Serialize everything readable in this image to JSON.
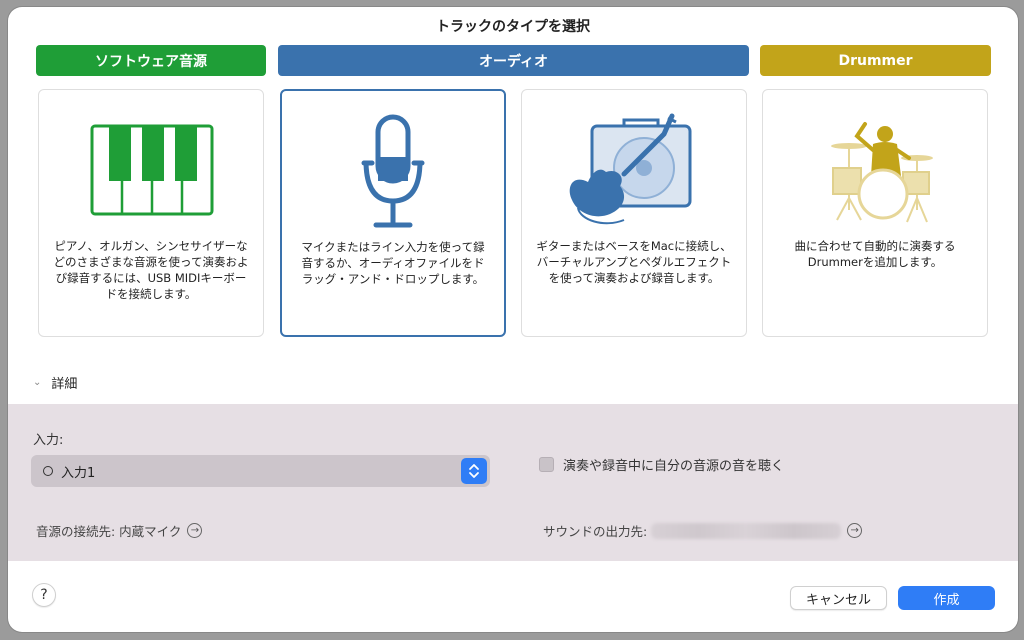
{
  "dialog": {
    "title": "トラックのタイプを選択"
  },
  "categories": [
    {
      "label": "ソフトウェア音源",
      "color": "#1f9e37"
    },
    {
      "label": "オーディオ",
      "color": "#3a72ad"
    },
    {
      "label": "Drummer",
      "color": "#c2a41a"
    }
  ],
  "cards": [
    {
      "icon": "piano-keyboard-icon",
      "description": "ピアノ、オルガン、シンセサイザーなどのさまざまな音源を使って演奏および録音するには、USB MIDIキーボードを接続します。",
      "selected": false
    },
    {
      "icon": "microphone-icon",
      "description": "マイクまたはライン入力を使って録音するか、オーディオファイルをドラッグ・アンド・ドロップします。",
      "selected": true
    },
    {
      "icon": "guitar-amp-icon",
      "description": "ギターまたはベースをMacに接続し、バーチャルアンプとペダルエフェクトを使って演奏および録音します。",
      "selected": false
    },
    {
      "icon": "drummer-icon",
      "description": "曲に合わせて自動的に演奏するDrummerを追加します。",
      "selected": false
    }
  ],
  "details": {
    "toggle_label": "詳細",
    "input_label": "入力:",
    "input_value": "入力1",
    "monitor_label": "演奏や録音中に自分の音源の音を聴く",
    "monitor_checked": false,
    "source_connection_label": "音源の接続先: 内蔵マイク",
    "sound_output_label": "サウンドの出力先:"
  },
  "footer": {
    "help_label": "?",
    "cancel_label": "キャンセル",
    "create_label": "作成"
  },
  "colors": {
    "accent": "#2f7df6",
    "audio_blue": "#3a72ad",
    "instrument_green": "#1f9e37",
    "drummer_gold": "#c2a41a"
  }
}
